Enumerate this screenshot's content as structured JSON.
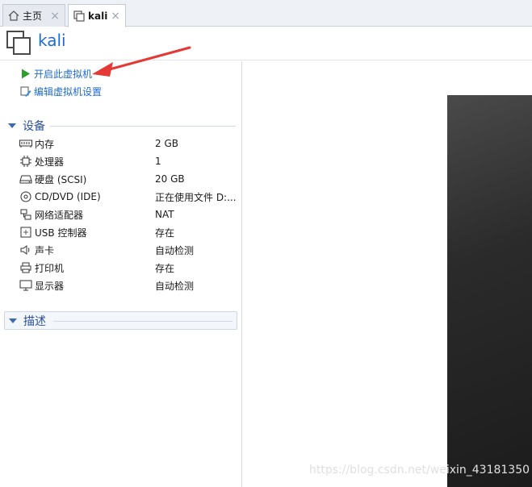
{
  "tabs": [
    {
      "label": "主页",
      "icon": "home-icon"
    },
    {
      "label": "kali",
      "icon": "vm-icon"
    }
  ],
  "tab_close": "×",
  "vm": {
    "name": "kali"
  },
  "actions": {
    "start_label": "开启此虚拟机",
    "edit_label": "编辑虚拟机设置"
  },
  "devices": {
    "header": "设备",
    "items": [
      {
        "name": "内存",
        "value": "2 GB",
        "icon": "memory-icon"
      },
      {
        "name": "处理器",
        "value": "1",
        "icon": "cpu-icon"
      },
      {
        "name": "硬盘 (SCSI)",
        "value": "20 GB",
        "icon": "harddisk-icon"
      },
      {
        "name": "CD/DVD (IDE)",
        "value": "正在使用文件 D:...",
        "icon": "cd-icon"
      },
      {
        "name": "网络适配器",
        "value": "NAT",
        "icon": "network-icon"
      },
      {
        "name": "USB 控制器",
        "value": "存在",
        "icon": "usb-icon"
      },
      {
        "name": "声卡",
        "value": "自动检测",
        "icon": "speaker-icon"
      },
      {
        "name": "打印机",
        "value": "存在",
        "icon": "printer-icon"
      },
      {
        "name": "显示器",
        "value": "自动检测",
        "icon": "monitor-icon"
      }
    ]
  },
  "description": {
    "header": "描述"
  },
  "watermark": "https://blog.csdn.net/weixin_43181350",
  "colors": {
    "accent": "#1f6bd0",
    "arrow": "#e53935",
    "play": "#2e9e2e",
    "console": "#2b2b2b"
  }
}
